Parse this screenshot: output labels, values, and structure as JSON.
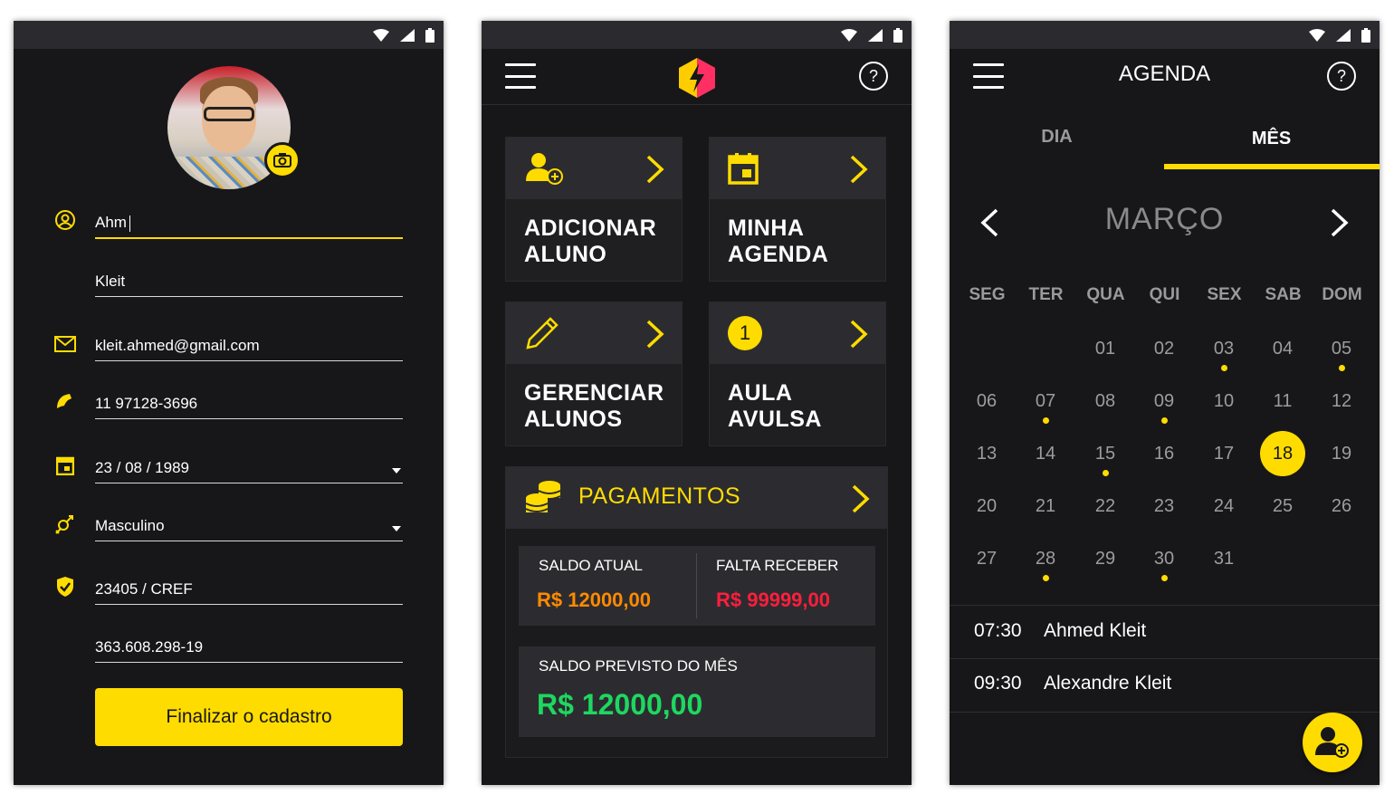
{
  "colors": {
    "accent": "#ffdc00",
    "background": "#17171a",
    "card": "#2c2c30",
    "orange": "#ff8a00",
    "red": "#ff1e3c",
    "green": "#1ed760"
  },
  "profile": {
    "first_name": "Ahm",
    "last_name": "Kleit",
    "email": "kleit.ahmed@gmail.com",
    "phone": "11 97128-3696",
    "birthdate": "23 / 08 / 1989",
    "gender": "Masculino",
    "cref": "23405 / CREF",
    "cpf": "363.608.298-19",
    "submit_label": "Finalizar o cadastro"
  },
  "home": {
    "cards": [
      {
        "label_1": "ADICIONAR",
        "label_2": "ALUNO",
        "icon": "add-user-icon"
      },
      {
        "label_1": "MINHA",
        "label_2": "AGENDA",
        "icon": "calendar-icon"
      },
      {
        "label_1": "GERENCIAR",
        "label_2": "ALUNOS",
        "icon": "pencil-icon"
      },
      {
        "label_1": "AULA",
        "label_2": "AVULSA",
        "icon": "number-one-icon",
        "badge": "1"
      }
    ],
    "payments": {
      "title": "PAGAMENTOS",
      "saldo_atual_label": "SALDO ATUAL",
      "saldo_atual_value": "R$ 12000,00",
      "falta_receber_label": "FALTA RECEBER",
      "falta_receber_value": "R$ 99999,00",
      "previsto_label": "SALDO PREVISTO DO MÊS",
      "previsto_value": "R$ 12000,00"
    }
  },
  "agenda": {
    "title": "AGENDA",
    "tabs": [
      "DIA",
      "MÊS"
    ],
    "active_tab": "MÊS",
    "month": "MARÇO",
    "weekdays": [
      "SEG",
      "TER",
      "QUA",
      "QUI",
      "SEX",
      "SAB",
      "DOM"
    ],
    "days": [
      [
        "",
        "",
        "01",
        "02",
        "03",
        "04",
        "05"
      ],
      [
        "06",
        "07",
        "08",
        "09",
        "10",
        "11",
        "12"
      ],
      [
        "13",
        "14",
        "15",
        "16",
        "17",
        "18",
        "19"
      ],
      [
        "20",
        "21",
        "22",
        "23",
        "24",
        "25",
        "26"
      ],
      [
        "27",
        "28",
        "29",
        "30",
        "31",
        "",
        ""
      ]
    ],
    "selected_day": "18",
    "days_with_events": [
      "03",
      "05",
      "07",
      "09",
      "15",
      "28",
      "30"
    ],
    "appointments": [
      {
        "time": "07:30",
        "name": "Ahmed Kleit"
      },
      {
        "time": "09:30",
        "name": "Alexandre Kleit"
      }
    ]
  }
}
